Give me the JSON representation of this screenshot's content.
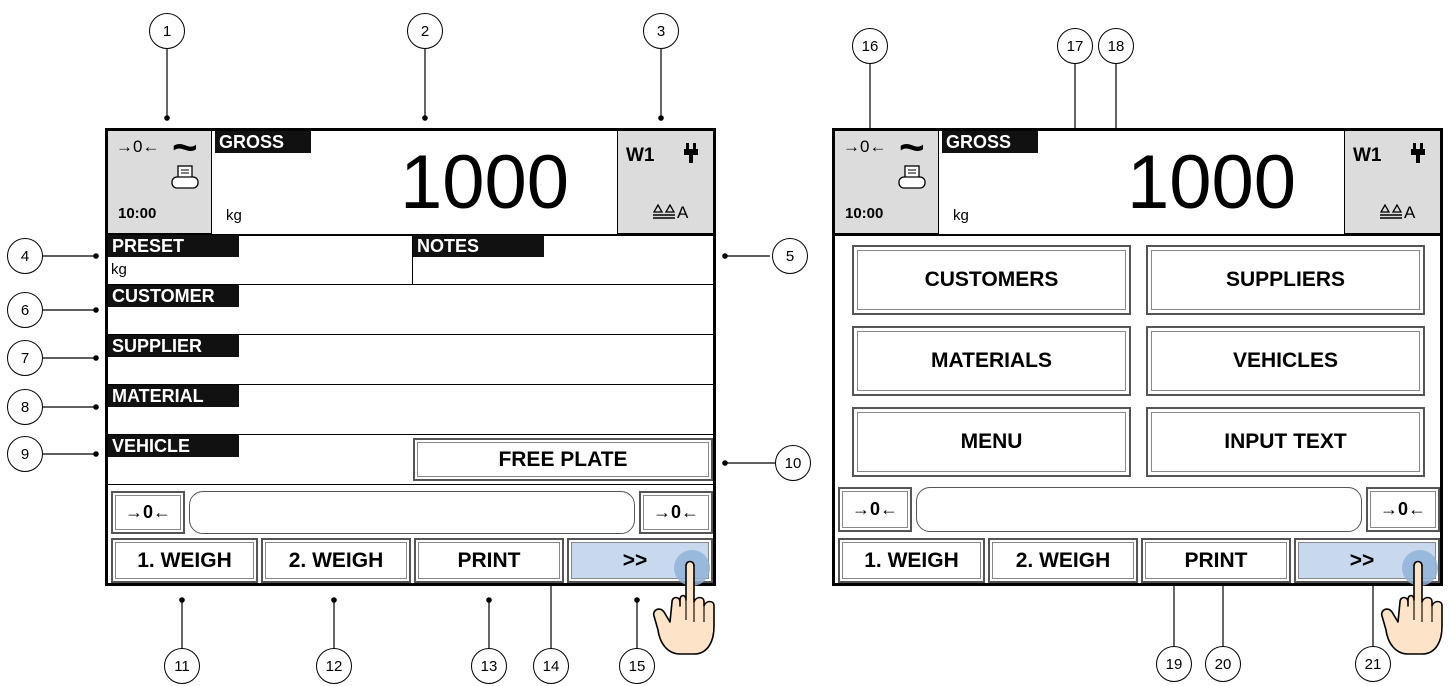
{
  "status": {
    "zero_symbol": "→0←",
    "stable_symbol": "~",
    "time": "10:00",
    "printer_icon": "printer-icon",
    "scale": "W1",
    "power_icon": "plug-icon",
    "scale_icon": "balance-icon",
    "scale_suffix": "A"
  },
  "weight": {
    "mode": "GROSS",
    "value": "1000",
    "unit": "kg"
  },
  "fields": {
    "preset": "PRESET",
    "preset_unit": "kg",
    "notes": "NOTES",
    "customer": "CUSTOMER",
    "supplier": "SUPPLIER",
    "material": "MATERIAL",
    "vehicle": "VEHICLE",
    "free_plate": "FREE PLATE"
  },
  "zero_button": "→0←",
  "function_keys": [
    "1. WEIGH",
    "2. WEIGH",
    "PRINT",
    ">>"
  ],
  "menu_buttons": [
    "CUSTOMERS",
    "SUPPLIERS",
    "MATERIALS",
    "VEHICLES",
    "MENU",
    "INPUT TEXT"
  ],
  "callouts": [
    "1",
    "2",
    "3",
    "4",
    "5",
    "6",
    "7",
    "8",
    "9",
    "10",
    "11",
    "12",
    "13",
    "14",
    "15",
    "16",
    "17",
    "18",
    "19",
    "20",
    "21"
  ]
}
